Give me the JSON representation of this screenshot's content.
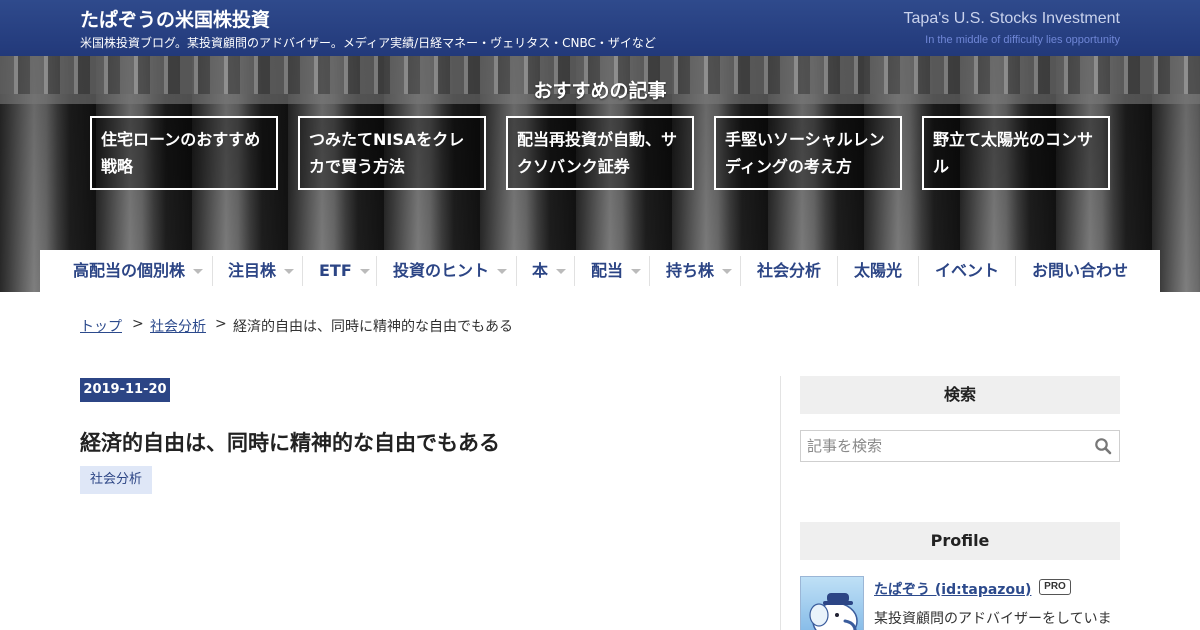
{
  "header": {
    "title": "たぱぞうの米国株投資",
    "description": "米国株投資ブログ。某投資顧問のアドバイザー。メディア実績/日経マネー・ヴェリタス・CNBC・ザイなど",
    "title_en": "Tapa's U.S. Stocks Investment",
    "tagline_en": "In the middle of difficulty lies opportunity"
  },
  "featured": {
    "heading": "おすすめの記事",
    "items": [
      {
        "label": "住宅ローンのおすすめ戦略"
      },
      {
        "label": "つみたてNISAをクレカで買う方法"
      },
      {
        "label": "配当再投資が自動、サクソバンク証券"
      },
      {
        "label": "手堅いソーシャルレンディングの考え方"
      },
      {
        "label": "野立て太陽光のコンサル"
      }
    ]
  },
  "nav": {
    "items": [
      {
        "label": "高配当の個別株"
      },
      {
        "label": "注目株"
      },
      {
        "label": "ETF"
      },
      {
        "label": "投資のヒント"
      },
      {
        "label": "本"
      },
      {
        "label": "配当"
      },
      {
        "label": "持ち株"
      },
      {
        "label": "社会分析"
      },
      {
        "label": "太陽光"
      },
      {
        "label": "イベント"
      },
      {
        "label": "お問い合わせ"
      }
    ]
  },
  "breadcrumb": {
    "top": "トップ",
    "separator": ">",
    "category": "社会分析",
    "current": "経済的自由は、同時に精神的な自由でもある"
  },
  "entry": {
    "date": "2019-11-20",
    "title": "経済的自由は、同時に精神的な自由でもある",
    "category": "社会分析"
  },
  "sidebar": {
    "search_heading": "検索",
    "search_placeholder": "記事を検索",
    "profile_heading": "Profile",
    "profile_name": "たぱぞう (id:tapazou)",
    "pro_badge": "PRO",
    "profile_desc": "某投資顧問のアドバイザーをしていま"
  },
  "colors": {
    "brand": "#2c4585",
    "link": "#2c4a8c",
    "tag_bg": "#dfe7f7"
  }
}
